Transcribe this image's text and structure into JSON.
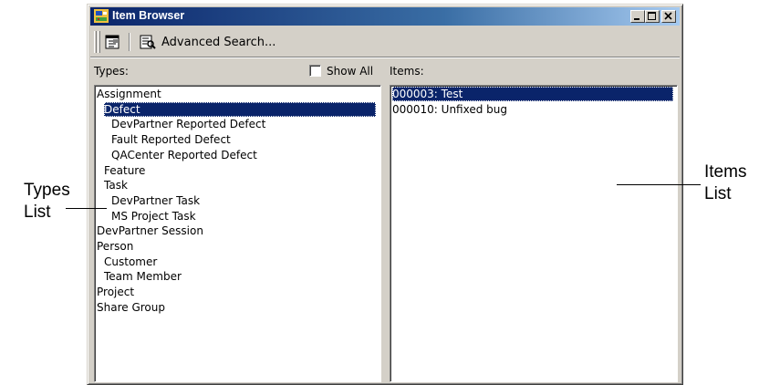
{
  "window": {
    "title": "Item Browser",
    "controls": {
      "minimize": "_",
      "maximize": "□",
      "close": "✕"
    }
  },
  "toolbar": {
    "advanced_search_label": "Advanced Search..."
  },
  "types_pane": {
    "label": "Types:",
    "show_all_label": "Show All",
    "show_all_checked": false,
    "items": [
      {
        "label": "Assignment",
        "indent": 0,
        "selected": false
      },
      {
        "label": "Defect",
        "indent": 1,
        "selected": true
      },
      {
        "label": "DevPartner Reported Defect",
        "indent": 2,
        "selected": false
      },
      {
        "label": "Fault Reported Defect",
        "indent": 2,
        "selected": false
      },
      {
        "label": "QACenter Reported Defect",
        "indent": 2,
        "selected": false
      },
      {
        "label": "Feature",
        "indent": 1,
        "selected": false
      },
      {
        "label": "Task",
        "indent": 1,
        "selected": false
      },
      {
        "label": "DevPartner Task",
        "indent": 2,
        "selected": false
      },
      {
        "label": "MS Project Task",
        "indent": 2,
        "selected": false
      },
      {
        "label": "DevPartner Session",
        "indent": 0,
        "selected": false
      },
      {
        "label": "Person",
        "indent": 0,
        "selected": false
      },
      {
        "label": "Customer",
        "indent": 1,
        "selected": false
      },
      {
        "label": "Team Member",
        "indent": 1,
        "selected": false
      },
      {
        "label": "Project",
        "indent": 0,
        "selected": false
      },
      {
        "label": "Share Group",
        "indent": 0,
        "selected": false
      }
    ]
  },
  "items_pane": {
    "label": "Items:",
    "items": [
      {
        "label": "000003: Test",
        "selected": true
      },
      {
        "label": "000010: Unfixed bug",
        "selected": false
      }
    ]
  },
  "callouts": {
    "types": {
      "line1": "Types",
      "line2": "List"
    },
    "items": {
      "line1": "Items",
      "line2": "List"
    }
  },
  "colors": {
    "selection": "#0a246a",
    "title_bar": "#0a246a",
    "face": "#d4d0c8"
  }
}
